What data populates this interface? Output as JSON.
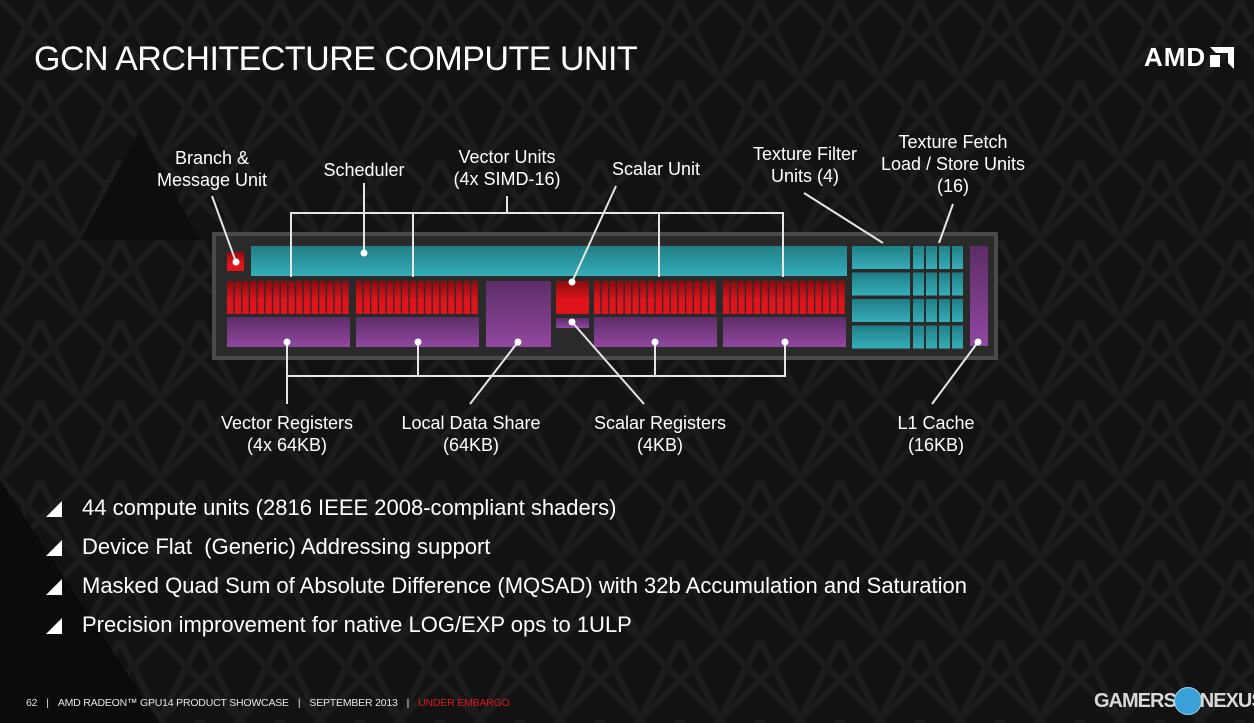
{
  "slide": {
    "title": "GCN ARCHITECTURE COMPUTE UNIT",
    "logo": "AMD",
    "colors": {
      "background": "#121212",
      "scheduler": "#2fa6ae",
      "simd": "#d4141a",
      "registers": "#8a3f9a",
      "cu_frame": "#2a2a2a",
      "accent_red": "#d9181d"
    }
  },
  "diagram": {
    "labels_top": {
      "branch": [
        "Branch &",
        "Message Unit"
      ],
      "scheduler": [
        "Scheduler"
      ],
      "vector_units": [
        "Vector Units",
        "(4x SIMD-16)"
      ],
      "scalar_unit": [
        "Scalar Unit"
      ],
      "texture_filter": [
        "Texture Filter",
        "Units (4)"
      ],
      "texture_fetch": [
        "Texture Fetch",
        "Load / Store Units",
        "(16)"
      ]
    },
    "labels_bottom": {
      "vector_registers": [
        "Vector Registers",
        "(4x 64KB)"
      ],
      "lds": [
        "Local Data Share",
        "(64KB)"
      ],
      "scalar_registers": [
        "Scalar Registers",
        "(4KB)"
      ],
      "l1_cache": [
        "L1 Cache",
        "(16KB)"
      ]
    },
    "simd_lanes_per_unit": 16,
    "texture_filter_rows": 4,
    "texture_fetch_units": 16
  },
  "bullets": [
    "44 compute units (2816 IEEE 2008-compliant shaders)",
    "Device Flat  (Generic) Addressing support",
    "Masked Quad Sum of Absolute Difference (MQSAD) with 32b Accumulation and Saturation",
    "Precision improvement for native LOG/EXP ops to 1ULP"
  ],
  "footer": {
    "page": "62",
    "event": "AMD RADEON™ GPU14 PRODUCT SHOWCASE",
    "date": "SEPTEMBER 2013",
    "status": "UNDER EMBARGO"
  },
  "watermark": {
    "left": "GAMERS",
    "right": "NEXUS"
  }
}
